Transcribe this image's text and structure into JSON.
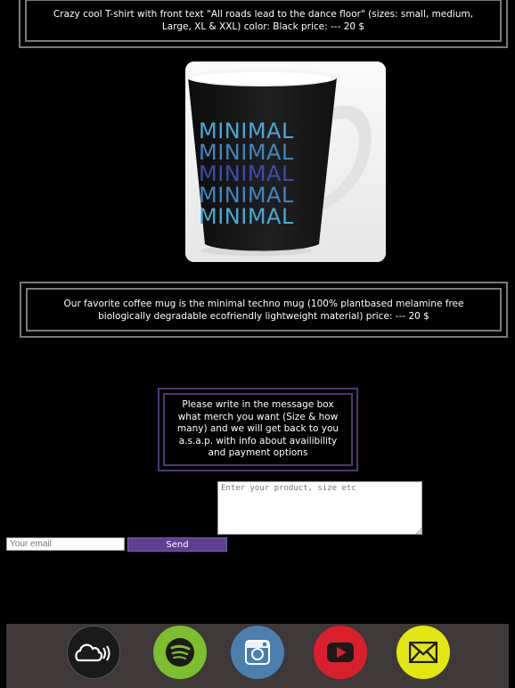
{
  "products": {
    "tshirt": {
      "description": "Crazy cool T-shirt with front text \"All roads lead to the dance floor\" (sizes: small, medium, Large, XL & XXL) color: Black price: --- 20 $"
    },
    "mug": {
      "image_text": "MINIMAL",
      "description": "Our favorite coffee mug is the minimal techno mug (100% plantbased melamine free biologically degradable ecofriendly lightweight material) price: --- 20 $"
    }
  },
  "order": {
    "instructions": "Please write in the message box what merch you want (Size & how many) and we will get back to you a.s.a.p. with info about availibility and payment options",
    "message_placeholder": "Enter your product, size etc",
    "email_placeholder": "Your email",
    "send_label": "Send"
  },
  "footer": {
    "links": [
      {
        "name": "soundcloud-icon",
        "color": "#1a1a1a"
      },
      {
        "name": "spotify-icon",
        "color": "#7bbf2f"
      },
      {
        "name": "instagram-icon",
        "color": "#4a7fae"
      },
      {
        "name": "youtube-icon",
        "color": "#d9202a"
      },
      {
        "name": "email-icon",
        "color": "#e3e60f"
      }
    ]
  }
}
